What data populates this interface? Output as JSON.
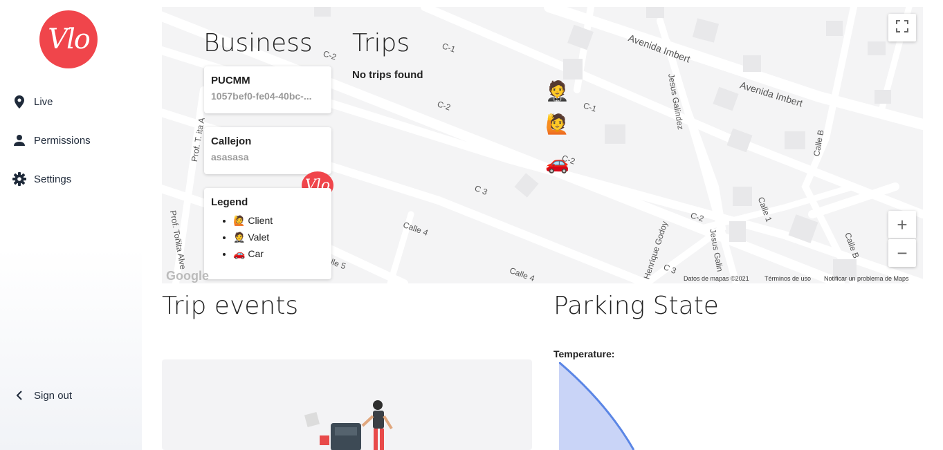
{
  "sidebar": {
    "logo_text": "Vlo",
    "items": [
      {
        "label": "Live",
        "icon": "location-pin-icon"
      },
      {
        "label": "Permissions",
        "icon": "person-icon"
      },
      {
        "label": "Settings",
        "icon": "gear-icon"
      }
    ],
    "sign_out": {
      "label": "Sign out",
      "icon": "chevron-left-icon"
    }
  },
  "map": {
    "business_title": "Business",
    "trips_title": "Trips",
    "no_trips": "No trips found",
    "businesses": [
      {
        "name": "PUCMM",
        "id": "1057bef0-fe04-40bc-..."
      },
      {
        "name": "Callejon",
        "id": "asasasa"
      }
    ],
    "legend": {
      "title": "Legend",
      "items": [
        {
          "emoji": "🙋",
          "label": "Client"
        },
        {
          "emoji": "🤵",
          "label": "Valet"
        },
        {
          "emoji": "🚗",
          "label": "Car"
        }
      ]
    },
    "markers": {
      "valet": "🤵",
      "client": "🙋",
      "car": "🚗"
    },
    "streets": {
      "avenida1": "Avenida Imbert",
      "avenida2": "Avenida Imbert",
      "c1a": "C-1",
      "c1b": "C-1",
      "c2a": "C-2",
      "c2b": "C-2",
      "c2c": "C-2",
      "c2d": "C-2",
      "c3a": "C 3",
      "c3b": "C 3",
      "calle4a": "Calle 4",
      "calle4b": "Calle 4",
      "calle5": "lle 5",
      "calleb1": "Calle B",
      "calleb2": "Calle B",
      "calle1": "Calle 1",
      "jesus1": "Jesus Galindez",
      "jesus2": "Jesus Galin",
      "henrique": "Henrique Godoy",
      "prof1": "Prof. T. ita A",
      "prof2": "Prof. Toñita Alve"
    },
    "attribution": {
      "data": "Datos de mapas ©2021",
      "terms": "Términos de uso",
      "report": "Notificar un problema de Maps",
      "google": "Google"
    },
    "controls": {
      "zoom_in": "+",
      "zoom_out": "−"
    }
  },
  "trip_events": {
    "title": "Trip events"
  },
  "parking": {
    "title": "Parking State",
    "temperature_label": "Temperature:"
  },
  "colors": {
    "brand": "#f0454b",
    "chart_stroke": "#5b86e5",
    "chart_fill": "#c9d4f7"
  }
}
